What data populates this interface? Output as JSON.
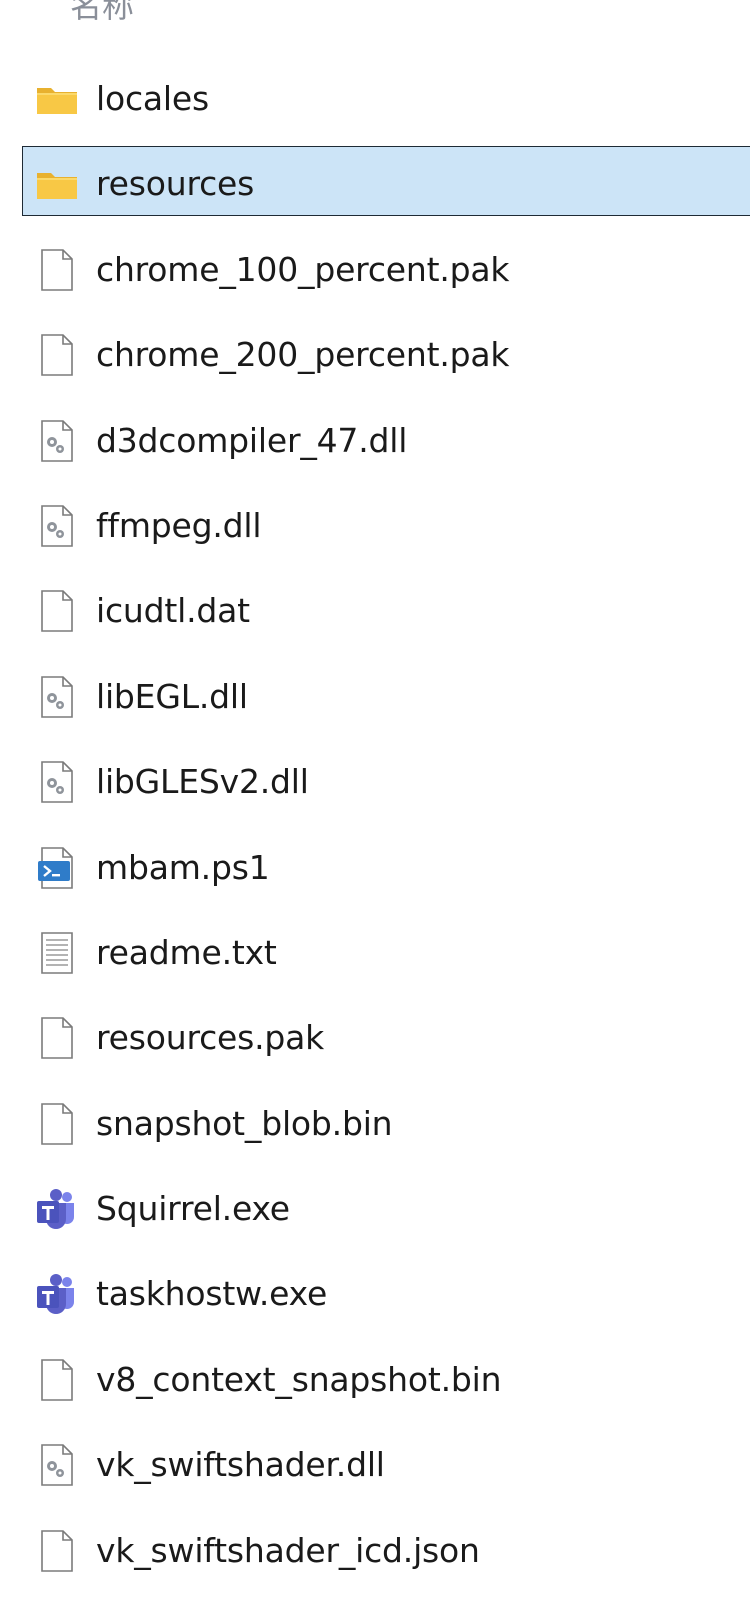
{
  "header": {
    "column_name": "名称"
  },
  "files": [
    {
      "name": "locales",
      "icon": "folder-icon",
      "type": "folder"
    },
    {
      "name": "resources",
      "icon": "folder-icon",
      "type": "folder",
      "selected": true
    },
    {
      "name": "chrome_100_percent.pak",
      "icon": "file-icon",
      "type": "file"
    },
    {
      "name": "chrome_200_percent.pak",
      "icon": "file-icon",
      "type": "file"
    },
    {
      "name": "d3dcompiler_47.dll",
      "icon": "dll-icon",
      "type": "dll"
    },
    {
      "name": "ffmpeg.dll",
      "icon": "dll-icon",
      "type": "dll"
    },
    {
      "name": "icudtl.dat",
      "icon": "file-icon",
      "type": "file"
    },
    {
      "name": "libEGL.dll",
      "icon": "dll-icon",
      "type": "dll"
    },
    {
      "name": "libGLESv2.dll",
      "icon": "dll-icon",
      "type": "dll"
    },
    {
      "name": "mbam.ps1",
      "icon": "powershell-script-icon",
      "type": "ps1"
    },
    {
      "name": "readme.txt",
      "icon": "text-file-icon",
      "type": "txt"
    },
    {
      "name": "resources.pak",
      "icon": "file-icon",
      "type": "file"
    },
    {
      "name": "snapshot_blob.bin",
      "icon": "file-icon",
      "type": "file"
    },
    {
      "name": "Squirrel.exe",
      "icon": "teams-app-icon",
      "type": "teams"
    },
    {
      "name": "taskhostw.exe",
      "icon": "teams-app-icon",
      "type": "teams"
    },
    {
      "name": "v8_context_snapshot.bin",
      "icon": "file-icon",
      "type": "file"
    },
    {
      "name": "vk_swiftshader.dll",
      "icon": "dll-icon",
      "type": "dll"
    },
    {
      "name": "vk_swiftshader_icd.json",
      "icon": "file-icon",
      "type": "file"
    }
  ],
  "colors": {
    "selection_bg": "#cce4f7",
    "selection_border": "#1e2a35",
    "folder": "#f8c845",
    "teams": "#5b5fc7"
  }
}
